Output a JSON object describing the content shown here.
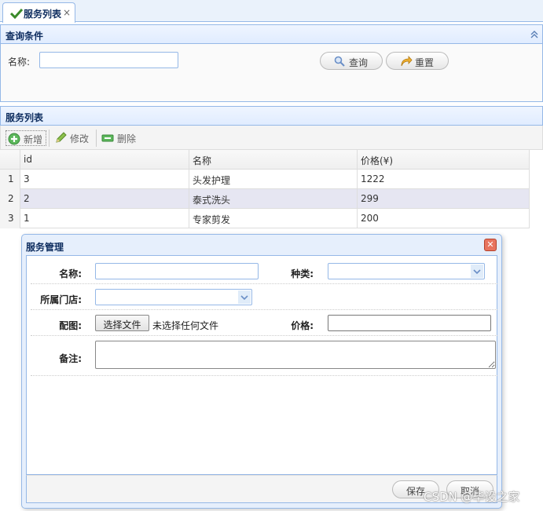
{
  "tab": {
    "label": "服务列表",
    "close": "×"
  },
  "query": {
    "title": "查询条件",
    "name_label": "名称:",
    "name_value": "",
    "search_button": "查询",
    "reset_button": "重置"
  },
  "list": {
    "title": "服务列表",
    "toolbar": {
      "add": "新增",
      "edit": "修改",
      "delete": "删除"
    },
    "columns": [
      "id",
      "名称",
      "价格(¥)"
    ],
    "rows": [
      {
        "num": "1",
        "id": "3",
        "name": "头发护理",
        "price": "1222"
      },
      {
        "num": "2",
        "id": "2",
        "name": "泰式洗头",
        "price": "299"
      },
      {
        "num": "3",
        "id": "1",
        "name": "专家剪发",
        "price": "200"
      }
    ]
  },
  "dialog": {
    "title": "服务管理",
    "name_label": "名称:",
    "category_label": "种类:",
    "store_label": "所属门店:",
    "image_label": "配图:",
    "choose_file": "选择文件",
    "no_file": "未选择任何文件",
    "price_label": "价格:",
    "note_label": "备注:",
    "save_button": "保存",
    "cancel_button": "取消"
  },
  "watermark": "CSDN @毕设之家",
  "colors": {
    "border": "#95b8e7",
    "header_text": "#0e2d5f",
    "selected_row": "#e6e6f2"
  }
}
